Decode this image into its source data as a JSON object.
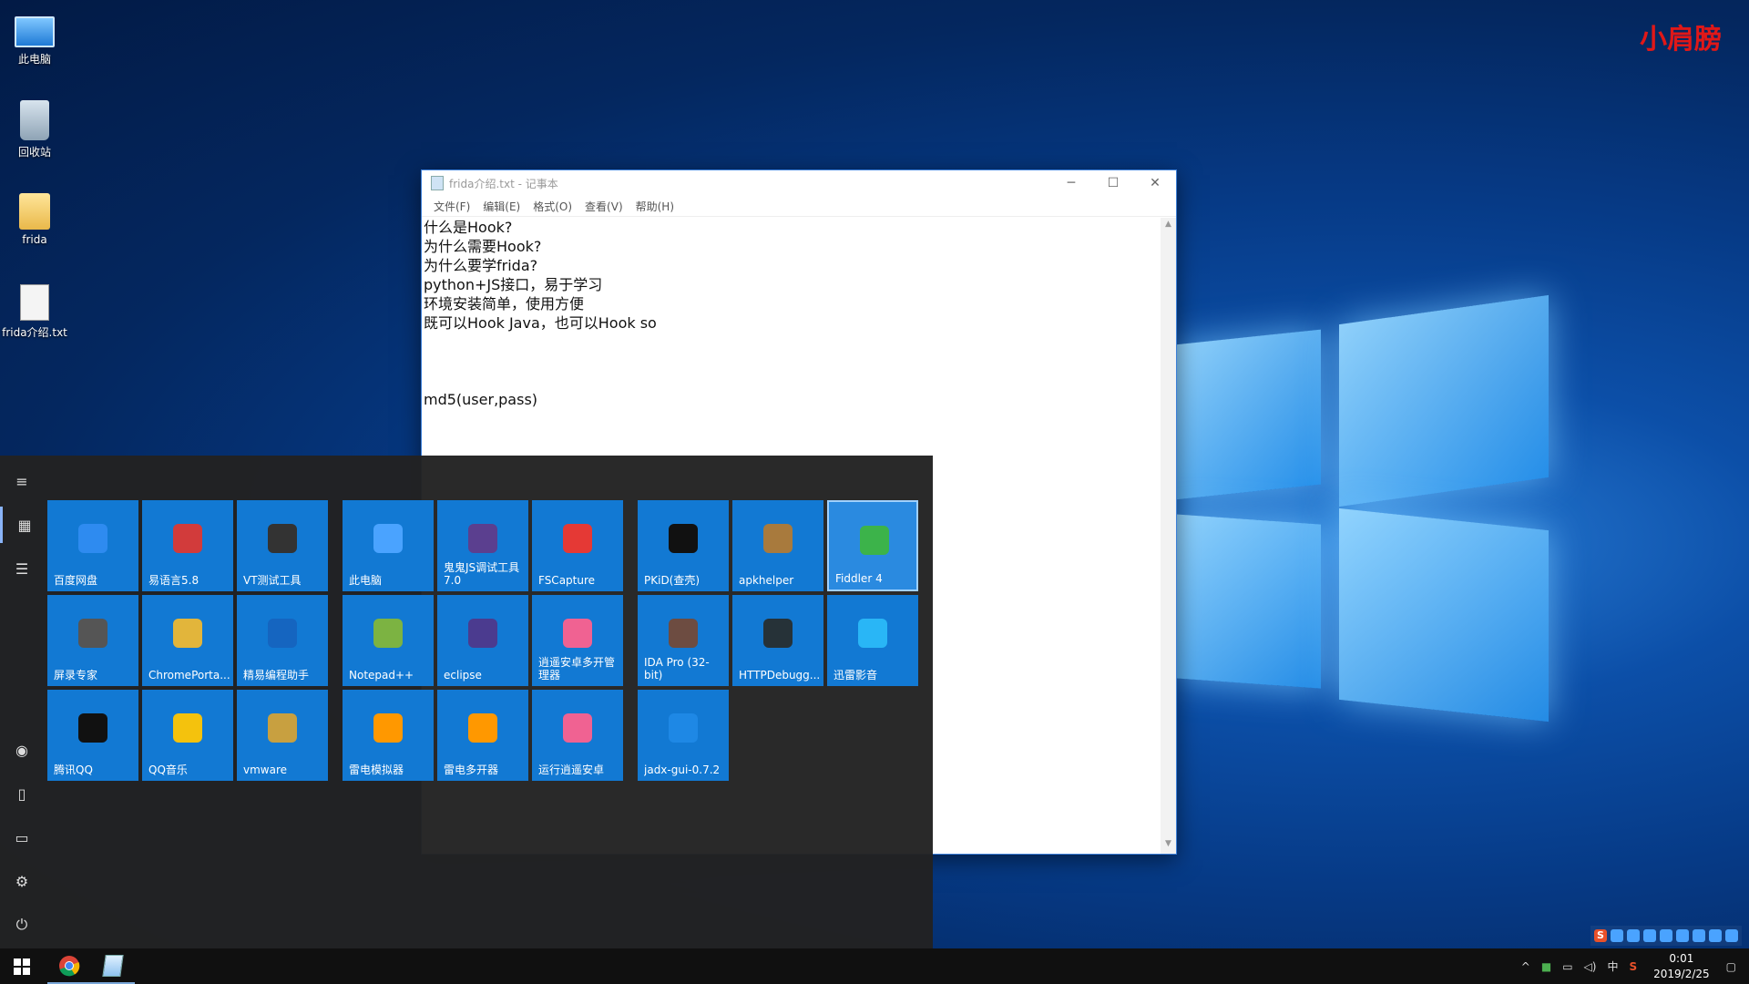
{
  "watermark": "小肩膀",
  "desktop_icons": [
    {
      "label": "此电脑",
      "icon": "computer-icon"
    },
    {
      "label": "回收站",
      "icon": "recycle-bin-icon"
    },
    {
      "label": "frida",
      "icon": "folder-icon"
    },
    {
      "label": "frida介绍.txt",
      "icon": "text-file-icon"
    }
  ],
  "notepad": {
    "title": "frida介绍.txt - 记事本",
    "menu": [
      "文件(F)",
      "编辑(E)",
      "格式(O)",
      "查看(V)",
      "帮助(H)"
    ],
    "lines": [
      "什么是Hook?",
      "为什么需要Hook?",
      "为什么要学frida?",
      "python+JS接口，易于学习",
      "环境安装简单，使用方便",
      "既可以Hook Java，也可以Hook so",
      "",
      "",
      "",
      "md5(user,pass)"
    ]
  },
  "start_menu": {
    "tiles": [
      {
        "label": "百度网盘",
        "icon": "baidu-netdisk-icon",
        "color": "#2e8bf0"
      },
      {
        "label": "易语言5.8",
        "icon": "eyuyan-icon",
        "color": "#d23b3b"
      },
      {
        "label": "VT测试工具",
        "icon": "cpu-icon",
        "color": "#333333"
      },
      {
        "label": "此电脑",
        "icon": "computer-icon",
        "color": "#4aa3ff"
      },
      {
        "label": "鬼鬼JS调试工具7.0",
        "icon": "b-icon",
        "color": "#5b3f8f"
      },
      {
        "label": "FSCapture",
        "icon": "fscapture-icon",
        "color": "#e53935"
      },
      {
        "label": "PKiD(查壳)",
        "icon": "pkid-icon",
        "color": "#111111"
      },
      {
        "label": "apkhelper",
        "icon": "box-icon",
        "color": "#a87a3d"
      },
      {
        "label": "Fiddler 4",
        "icon": "fiddler-icon",
        "color": "#3cb34a"
      },
      {
        "label": "屏录专家",
        "icon": "screen-recorder-icon",
        "color": "#555555"
      },
      {
        "label": "ChromePorta...",
        "icon": "chrome-icon",
        "color": "#e2b53b"
      },
      {
        "label": "精易编程助手",
        "icon": "e-icon",
        "color": "#1565c0"
      },
      {
        "label": "Notepad++",
        "icon": "notepad-plus-icon",
        "color": "#7cb342"
      },
      {
        "label": "eclipse",
        "icon": "eclipse-icon",
        "color": "#4b3b8f"
      },
      {
        "label": "逍遥安卓多开管理器",
        "icon": "xiaoyao-icon",
        "color": "#f06292"
      },
      {
        "label": "IDA Pro (32-bit)",
        "icon": "ida-icon",
        "color": "#6d4c41"
      },
      {
        "label": "HTTPDebugg...",
        "icon": "http-debugger-icon",
        "color": "#263238"
      },
      {
        "label": "迅雷影音",
        "icon": "xunlei-player-icon",
        "color": "#29b6f6"
      },
      {
        "label": "腾讯QQ",
        "icon": "qq-icon",
        "color": "#111111"
      },
      {
        "label": "QQ音乐",
        "icon": "qq-music-icon",
        "color": "#f4c20d"
      },
      {
        "label": "vmware",
        "icon": "vmware-icon",
        "color": "#c8a040"
      },
      {
        "label": "雷电模拟器",
        "icon": "leidian-icon",
        "color": "#ff9800"
      },
      {
        "label": "雷电多开器",
        "icon": "leidian-multi-icon",
        "color": "#ff9800"
      },
      {
        "label": "运行逍遥安卓",
        "icon": "xiaoyao-run-icon",
        "color": "#f06292"
      },
      {
        "label": "jadx-gui-0.7.2",
        "icon": "jadx-icon",
        "color": "#1e88e5"
      }
    ]
  },
  "taskbar": {
    "ime": "中",
    "time": "0:01",
    "date": "2019/2/25"
  }
}
